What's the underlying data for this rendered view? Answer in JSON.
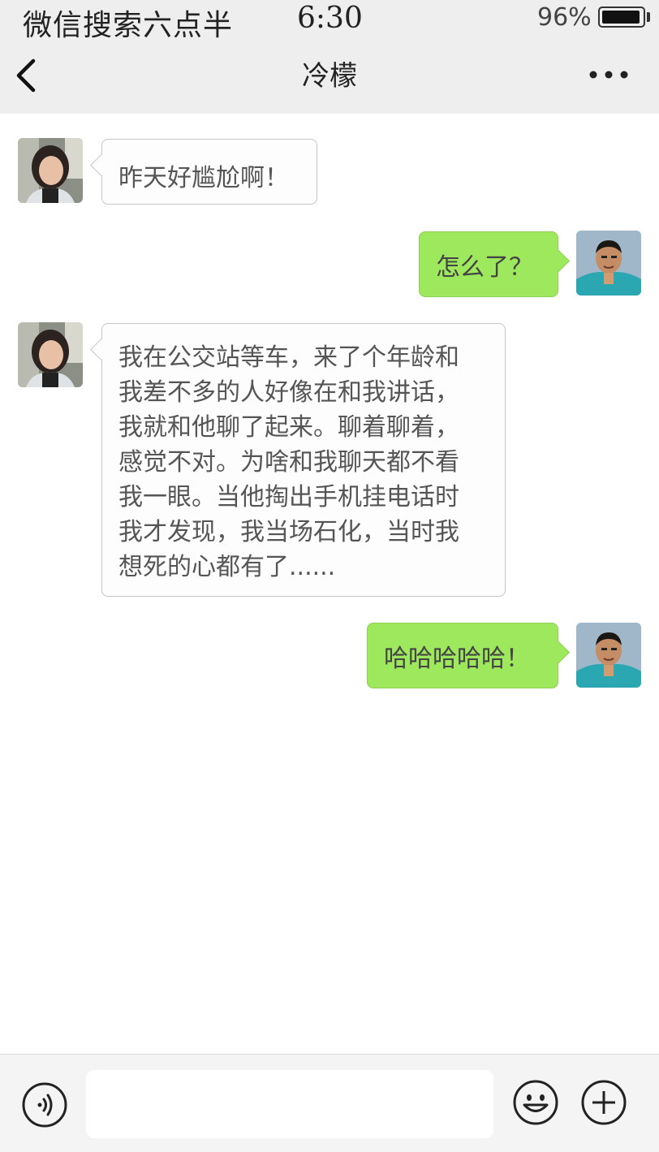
{
  "status_bar": {
    "carrier": "微信搜索六点半",
    "time": "6:30",
    "battery_text": "96%",
    "battery_level": 0.96
  },
  "nav": {
    "back_icon": "chevron-left-icon",
    "title": "冷檬",
    "more_icon": "ellipsis-icon"
  },
  "messages": [
    {
      "side": "left",
      "sender": "contact",
      "text": "昨天好尴尬啊！"
    },
    {
      "side": "right",
      "sender": "me",
      "text": "怎么了？"
    },
    {
      "side": "left",
      "sender": "contact",
      "lines": [
        "我在公交站等车，来了个年龄和",
        "我差不多的人好像在和我讲话，",
        "我就和他聊了起来。聊着聊着，",
        "感觉不对。为啥和我聊天都不看",
        "我一眼。当他掏出手机挂电话时",
        "我才发现，我当场石化，当时我",
        "想死的心都有了......"
      ]
    },
    {
      "side": "right",
      "sender": "me",
      "text": "哈哈哈哈哈！"
    }
  ],
  "input_bar": {
    "voice_icon": "voice-icon",
    "input_value": "",
    "emoji_icon": "emoji-icon",
    "plus_icon": "plus-icon"
  },
  "colors": {
    "header_bg": "#eeeeee",
    "bubble_right": "#9ee85e",
    "bubble_left": "#fdfdfd"
  }
}
